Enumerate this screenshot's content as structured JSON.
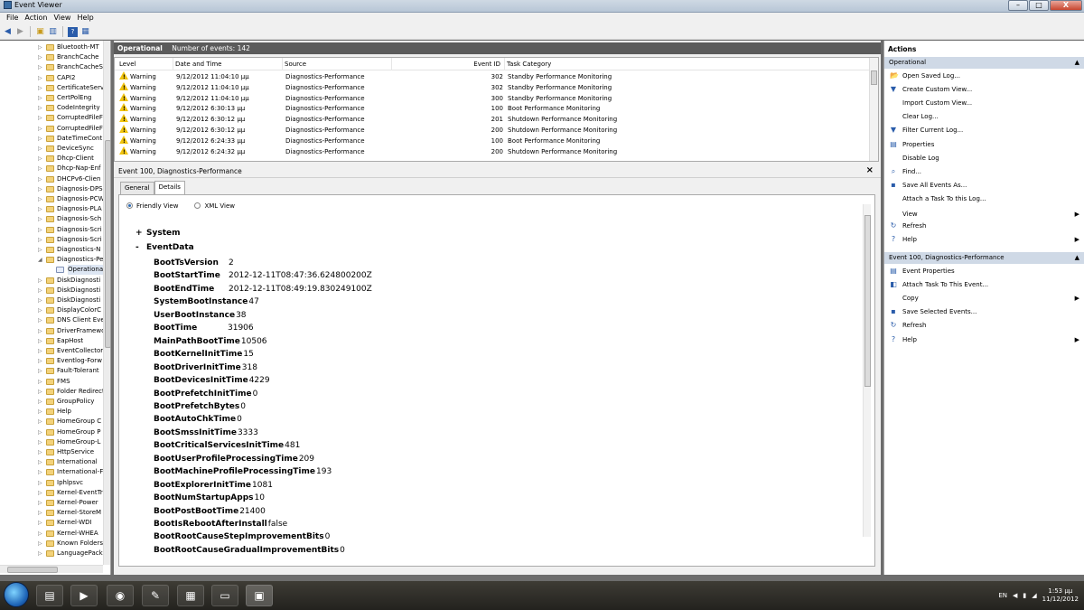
{
  "window": {
    "title": "Event Viewer",
    "ghost_tabs": [
      "",
      "",
      "",
      "",
      "",
      "",
      ""
    ],
    "buttons": {
      "minimize": "–",
      "maximize": "□",
      "close": "X"
    }
  },
  "menu": [
    "File",
    "Action",
    "View",
    "Help"
  ],
  "tree": {
    "items": [
      "Bluetooth-MT",
      "BranchCache",
      "BranchCacheS",
      "CAPI2",
      "CertificateServ",
      "CertPolEng",
      "CodeIntegrity",
      "CorruptedFileF",
      "CorruptedFileF",
      "DateTimeCont",
      "DeviceSync",
      "Dhcp-Client",
      "Dhcp-Nap-Enf",
      "DHCPv6-Clien",
      "Diagnosis-DPS",
      "Diagnosis-PCW",
      "Diagnosis-PLA",
      "Diagnosis-Sch",
      "Diagnosis-Scri",
      "Diagnosis-Scri",
      "Diagnostics-N",
      "Diagnostics-Pe"
    ],
    "selected_child": "Operationa",
    "items_after": [
      "DiskDiagnosti",
      "DiskDiagnosti",
      "DiskDiagnosti",
      "DisplayColorC",
      "DNS Client Eve",
      "DriverFramewo",
      "EapHost",
      "EventCollector",
      "Eventlog-Forw",
      "Fault-Tolerant",
      "FMS",
      "Folder Redirect",
      "GroupPolicy",
      "Help",
      "HomeGroup C",
      "HomeGroup P",
      "HomeGroup-L",
      "HttpService",
      "International",
      "International-F",
      "Iphlpsvc",
      "Kernel-EventTr",
      "Kernel-Power",
      "Kernel-StoreM",
      "Kernel-WDI",
      "Kernel-WHEA",
      "Known Folders",
      "LanguagePack"
    ]
  },
  "operational": {
    "title": "Operational",
    "count_text": "Number of events: 142"
  },
  "grid": {
    "headers": [
      "Level",
      "Date and Time",
      "Source",
      "Event ID",
      "Task Category"
    ],
    "rows": [
      {
        "level": "Warning",
        "date": "9/12/2012 11:04:10 μμ",
        "source": "Diagnostics-Performance",
        "id": "302",
        "task": "Standby Performance Monitoring"
      },
      {
        "level": "Warning",
        "date": "9/12/2012 11:04:10 μμ",
        "source": "Diagnostics-Performance",
        "id": "302",
        "task": "Standby Performance Monitoring"
      },
      {
        "level": "Warning",
        "date": "9/12/2012 11:04:10 μμ",
        "source": "Diagnostics-Performance",
        "id": "300",
        "task": "Standby Performance Monitoring"
      },
      {
        "level": "Warning",
        "date": "9/12/2012 6:30:13 μμ",
        "source": "Diagnostics-Performance",
        "id": "100",
        "task": "Boot Performance Monitoring"
      },
      {
        "level": "Warning",
        "date": "9/12/2012 6:30:12 μμ",
        "source": "Diagnostics-Performance",
        "id": "201",
        "task": "Shutdown Performance Monitoring"
      },
      {
        "level": "Warning",
        "date": "9/12/2012 6:30:12 μμ",
        "source": "Diagnostics-Performance",
        "id": "200",
        "task": "Shutdown Performance Monitoring"
      },
      {
        "level": "Warning",
        "date": "9/12/2012 6:24:33 μμ",
        "source": "Diagnostics-Performance",
        "id": "100",
        "task": "Boot Performance Monitoring"
      },
      {
        "level": "Warning",
        "date": "9/12/2012 6:24:32 μμ",
        "source": "Diagnostics-Performance",
        "id": "200",
        "task": "Shutdown Performance Monitoring"
      }
    ]
  },
  "event": {
    "header": "Event 100, Diagnostics-Performance",
    "close": "×",
    "tabs": [
      "General",
      "Details"
    ],
    "views": [
      "Friendly View",
      "XML View"
    ],
    "system_label": "System",
    "eventdata_label": "EventData",
    "plus": "+",
    "minus": "-",
    "fields": [
      {
        "k": "BootTsVersion",
        "v": "2"
      },
      {
        "k": "BootStartTime",
        "v": "2012-12-11T08:47:36.624800200Z"
      },
      {
        "k": "BootEndTime",
        "v": "2012-12-11T08:49:19.830249100Z"
      },
      {
        "k": "SystemBootInstance",
        "v": "47"
      },
      {
        "k": "UserBootInstance",
        "v": "38"
      },
      {
        "k": "BootTime",
        "v": "31906"
      },
      {
        "k": "MainPathBootTime",
        "v": "10506"
      },
      {
        "k": "BootKernelInitTime",
        "v": "15"
      },
      {
        "k": "BootDriverInitTime",
        "v": "318"
      },
      {
        "k": "BootDevicesInitTime",
        "v": "4229"
      },
      {
        "k": "BootPrefetchInitTime",
        "v": "0"
      },
      {
        "k": "BootPrefetchBytes",
        "v": "0"
      },
      {
        "k": "BootAutoChkTime",
        "v": "0"
      },
      {
        "k": "BootSmssInitTime",
        "v": "3333"
      },
      {
        "k": "BootCriticalServicesInitTime",
        "v": "481"
      },
      {
        "k": "BootUserProfileProcessingTime",
        "v": "209"
      },
      {
        "k": "BootMachineProfileProcessingTime",
        "v": "193"
      },
      {
        "k": "BootExplorerInitTime",
        "v": "1081"
      },
      {
        "k": "BootNumStartupApps",
        "v": "10"
      },
      {
        "k": "BootPostBootTime",
        "v": "21400"
      },
      {
        "k": "BootIsRebootAfterInstall",
        "v": "false"
      },
      {
        "k": "BootRootCauseStepImprovementBits",
        "v": "0"
      },
      {
        "k": "BootRootCauseGradualImprovementBits",
        "v": "0"
      }
    ]
  },
  "actions": {
    "title": "Actions",
    "section1": "Operational",
    "section1_items": [
      {
        "label": "Open Saved Log...",
        "icon": "folder-open-icon",
        "glyph": "📂",
        "sub": ""
      },
      {
        "label": "Create Custom View...",
        "icon": "funnel-icon",
        "glyph": "▼",
        "sub": ""
      },
      {
        "label": "Import Custom View...",
        "icon": "import-icon",
        "glyph": "",
        "sub": ""
      },
      {
        "label": "Clear Log...",
        "icon": "clear-icon",
        "glyph": "",
        "sub": ""
      },
      {
        "label": "Filter Current Log...",
        "icon": "filter-icon",
        "glyph": "▼",
        "sub": ""
      },
      {
        "label": "Properties",
        "icon": "properties-icon",
        "glyph": "▤",
        "sub": ""
      },
      {
        "label": "Disable Log",
        "icon": "disable-icon",
        "glyph": "",
        "sub": ""
      },
      {
        "label": "Find...",
        "icon": "binoculars-icon",
        "glyph": "⌕",
        "sub": ""
      },
      {
        "label": "Save All Events As...",
        "icon": "save-icon",
        "glyph": "▪",
        "sub": ""
      },
      {
        "label": "Attach a Task To this Log...",
        "icon": "task-icon",
        "glyph": "",
        "sub": ""
      },
      {
        "label": "View",
        "icon": "view-icon",
        "glyph": "",
        "sub": "▶"
      },
      {
        "label": "Refresh",
        "icon": "refresh-icon",
        "glyph": "↻",
        "sub": ""
      },
      {
        "label": "Help",
        "icon": "help-icon",
        "glyph": "?",
        "sub": "▶"
      }
    ],
    "section2": "Event 100, Diagnostics-Performance",
    "section2_items": [
      {
        "label": "Event Properties",
        "icon": "event-properties-icon",
        "glyph": "▤",
        "sub": ""
      },
      {
        "label": "Attach Task To This Event...",
        "icon": "attach-task-icon",
        "glyph": "◧",
        "sub": ""
      },
      {
        "label": "Copy",
        "icon": "copy-icon",
        "glyph": "",
        "sub": "▶"
      },
      {
        "label": "Save Selected Events...",
        "icon": "save-selected-icon",
        "glyph": "▪",
        "sub": ""
      },
      {
        "label": "Refresh",
        "icon": "refresh-icon",
        "glyph": "↻",
        "sub": ""
      },
      {
        "label": "Help",
        "icon": "help-icon",
        "glyph": "?",
        "sub": "▶"
      }
    ],
    "collapse": "▲"
  },
  "taskbar": {
    "apps": [
      "explorer-icon",
      "media-player-icon",
      "chrome-icon",
      "acrobat-icon",
      "excel-icon",
      "remote-desktop-icon",
      "event-viewer-icon"
    ],
    "lang": "EN",
    "time": "1:53 μμ",
    "date": "11/12/2012"
  }
}
